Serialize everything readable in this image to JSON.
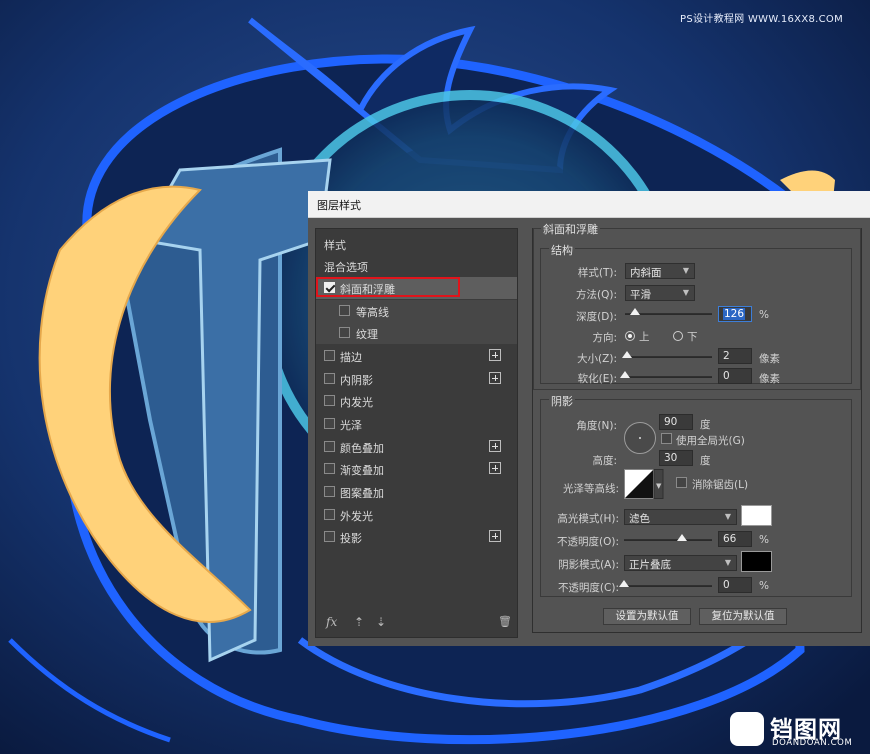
{
  "watermark": {
    "top": "PS设计教程网 WWW.16XX8.COM",
    "logo_big": "铛图网",
    "logo_small": "DOANDOAN.COM"
  },
  "dialog": {
    "title": "图层样式",
    "left_panel": {
      "header": "样式",
      "blend_options": "混合选项",
      "items": [
        {
          "label": "斜面和浮雕",
          "checked": true,
          "has_plus": false,
          "selected": true
        },
        {
          "label": "等高线",
          "checked": false,
          "has_plus": false,
          "sub": true
        },
        {
          "label": "纹理",
          "checked": false,
          "has_plus": false,
          "sub": true
        },
        {
          "label": "描边",
          "checked": false,
          "has_plus": true
        },
        {
          "label": "内阴影",
          "checked": false,
          "has_plus": true
        },
        {
          "label": "内发光",
          "checked": false,
          "has_plus": false
        },
        {
          "label": "光泽",
          "checked": false,
          "has_plus": false
        },
        {
          "label": "颜色叠加",
          "checked": false,
          "has_plus": true
        },
        {
          "label": "渐变叠加",
          "checked": false,
          "has_plus": true
        },
        {
          "label": "图案叠加",
          "checked": false,
          "has_plus": false
        },
        {
          "label": "外发光",
          "checked": false,
          "has_plus": false
        },
        {
          "label": "投影",
          "checked": false,
          "has_plus": true
        }
      ],
      "tools": {
        "fx": "fx",
        "up": "⇡",
        "down": "⇣",
        "trash": "🗑"
      }
    },
    "bevel": {
      "section_title": "斜面和浮雕",
      "structure_title": "结构",
      "style_label": "样式(T):",
      "style_value": "内斜面",
      "technique_label": "方法(Q):",
      "technique_value": "平滑",
      "depth_label": "深度(D):",
      "depth_value": "126",
      "depth_unit": "%",
      "direction_label": "方向:",
      "direction_up": "上",
      "direction_down": "下",
      "size_label": "大小(Z):",
      "size_value": "2",
      "size_unit": "像素",
      "soften_label": "软化(E):",
      "soften_value": "0",
      "soften_unit": "像素"
    },
    "shading": {
      "title": "阴影",
      "angle_label": "角度(N):",
      "angle_value": "90",
      "angle_unit": "度",
      "global_light_label": "使用全局光(G)",
      "altitude_label": "高度:",
      "altitude_value": "30",
      "altitude_unit": "度",
      "gloss_label": "光泽等高线:",
      "anti_alias_label": "消除锯齿(L)",
      "highlight_mode_label": "高光模式(H):",
      "highlight_mode_value": "滤色",
      "highlight_color": "#ffffff",
      "highlight_opacity_label": "不透明度(O):",
      "highlight_opacity_value": "66",
      "highlight_opacity_unit": "%",
      "shadow_mode_label": "阴影模式(A):",
      "shadow_mode_value": "正片叠底",
      "shadow_color": "#000000",
      "shadow_opacity_label": "不透明度(C):",
      "shadow_opacity_value": "0",
      "shadow_opacity_unit": "%"
    },
    "buttons": {
      "make_default": "设置为默认值",
      "reset_default": "复位为默认值"
    }
  },
  "levels": {
    "depth": 0.12,
    "size": 0.02,
    "soften": 0.0,
    "highlight_opacity": 0.66,
    "shadow_opacity": 0.0
  }
}
